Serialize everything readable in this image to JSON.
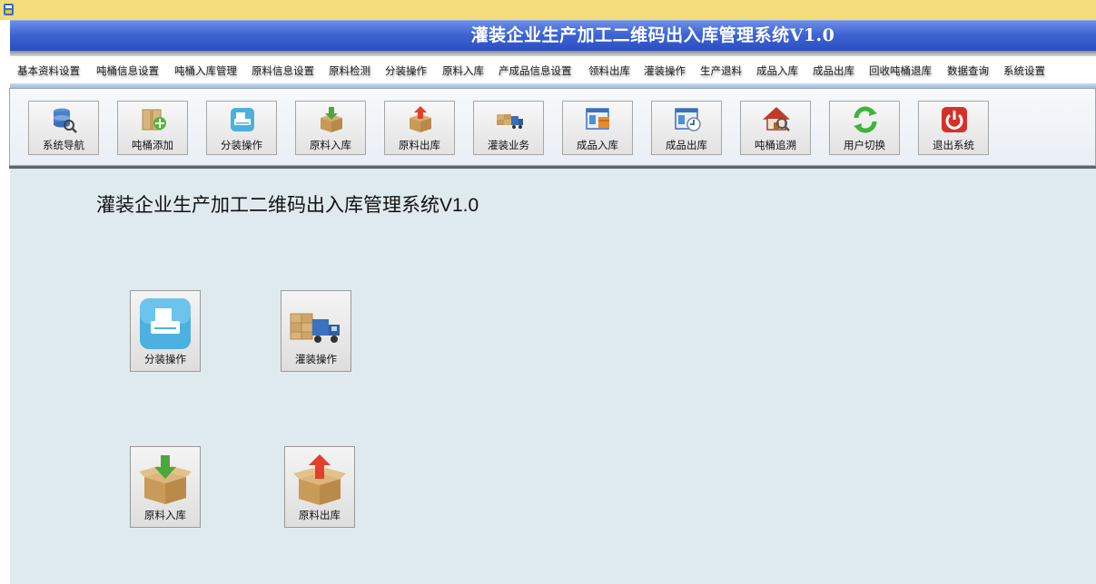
{
  "window": {
    "title": "灌装企业生产加工二维码出入库管理系统V1.0"
  },
  "menu": {
    "items": [
      {
        "label": "基本资料设置"
      },
      {
        "label": "吨桶信息设置"
      },
      {
        "label": "吨桶入库管理"
      },
      {
        "label": "原料信息设置"
      },
      {
        "label": "原料检测"
      },
      {
        "label": "分装操作"
      },
      {
        "label": "原料入库"
      },
      {
        "label": "产成品信息设置"
      },
      {
        "label": "领料出库"
      },
      {
        "label": "灌装操作"
      },
      {
        "label": "生产退料"
      },
      {
        "label": "成品入库"
      },
      {
        "label": "成品出库"
      },
      {
        "label": "回收吨桶退库"
      },
      {
        "label": "数据查询"
      },
      {
        "label": "系统设置"
      }
    ]
  },
  "toolbar": {
    "buttons": [
      {
        "label": "系统导航",
        "icon": "database-search-icon"
      },
      {
        "label": "吨桶添加",
        "icon": "box-add-icon"
      },
      {
        "label": "分装操作",
        "icon": "printer-icon"
      },
      {
        "label": "原料入库",
        "icon": "box-in-icon"
      },
      {
        "label": "原料出库",
        "icon": "box-out-icon"
      },
      {
        "label": "灌装业务",
        "icon": "truck-icon"
      },
      {
        "label": "成品入库",
        "icon": "window-in-icon"
      },
      {
        "label": "成品出库",
        "icon": "window-out-icon"
      },
      {
        "label": "吨桶追溯",
        "icon": "house-search-icon"
      },
      {
        "label": "用户切换",
        "icon": "refresh-icon"
      },
      {
        "label": "退出系统",
        "icon": "power-icon"
      }
    ]
  },
  "main": {
    "title": "灌装企业生产加工二维码出入库管理系统V1.0",
    "shortcuts": [
      {
        "label": "分装操作",
        "icon": "printer-icon"
      },
      {
        "label": "灌装操作",
        "icon": "truck-icon"
      },
      {
        "label": "原料入库",
        "icon": "box-in-icon"
      },
      {
        "label": "原料出库",
        "icon": "box-out-icon"
      }
    ]
  }
}
